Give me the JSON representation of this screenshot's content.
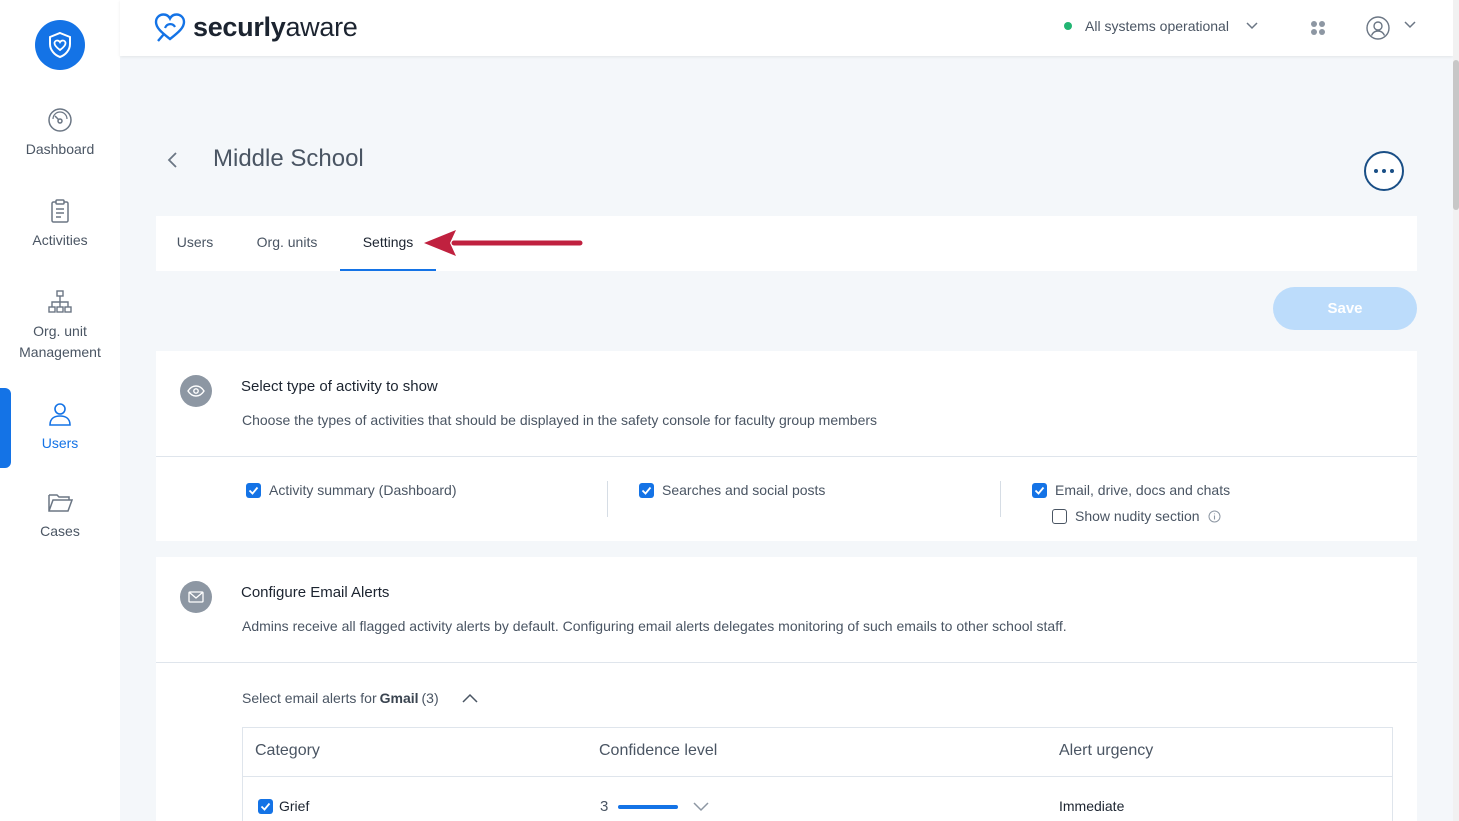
{
  "brand": {
    "name_bold": "securly",
    "name_light": "aware"
  },
  "topbar": {
    "status_text": "All systems operational",
    "status_color": "#22b573"
  },
  "sidebar": {
    "items": [
      {
        "label": "Dashboard",
        "icon": "dashboard-gauge-icon"
      },
      {
        "label": "Activities",
        "icon": "clipboard-icon"
      },
      {
        "label_line1": "Org. unit",
        "label_line2": "Management",
        "icon": "org-chart-icon"
      },
      {
        "label": "Users",
        "icon": "user-icon",
        "active": true
      },
      {
        "label": "Cases",
        "icon": "folder-icon"
      }
    ]
  },
  "page": {
    "title": "Middle School"
  },
  "tabs": [
    {
      "label": "Users"
    },
    {
      "label": "Org. units"
    },
    {
      "label": "Settings",
      "active": true
    }
  ],
  "save_label": "Save",
  "activity_card": {
    "title": "Select type of activity to show",
    "description": "Choose the types of activities that should be displayed in the safety console for faculty group members",
    "options": [
      {
        "label": "Activity summary (Dashboard)",
        "checked": true
      },
      {
        "label": "Searches and social posts",
        "checked": true
      },
      {
        "label": "Email, drive, docs and chats",
        "checked": true
      },
      {
        "label": "Show nudity section",
        "checked": false
      }
    ]
  },
  "email_card": {
    "title": "Configure Email Alerts",
    "description": "Admins receive all flagged activity alerts by default. Configuring email alerts delegates monitoring of such emails to other school staff.",
    "sub_prefix": "Select email alerts for",
    "sub_provider": "Gmail",
    "sub_count": "(3)",
    "table": {
      "headers": [
        "Category",
        "Confidence level",
        "Alert urgency"
      ],
      "rows": [
        {
          "category": "Grief",
          "checked": true,
          "level": "3",
          "urgency": "Immediate"
        }
      ]
    }
  },
  "colors": {
    "accent": "#1473e6",
    "save_disabled": "#bcdcfb",
    "annotation_arrow": "#c0213f"
  }
}
